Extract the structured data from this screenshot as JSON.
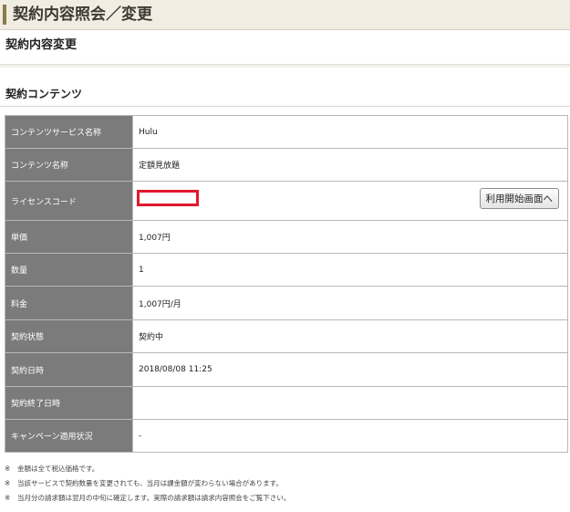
{
  "header": {
    "title": "契約内容照会／変更"
  },
  "page": {
    "subtitle": "契約内容変更"
  },
  "section": {
    "title": "契約コンテンツ"
  },
  "table": {
    "rows": [
      {
        "label": "コンテンツサービス名称",
        "value": "Hulu"
      },
      {
        "label": "コンテンツ名称",
        "value": "定額見放題"
      },
      {
        "label": "ライセンスコード",
        "value": ""
      },
      {
        "label": "単価",
        "value": "1,007円"
      },
      {
        "label": "数量",
        "value": "1"
      },
      {
        "label": "料金",
        "value": "1,007円/月"
      },
      {
        "label": "契約状態",
        "value": "契約中"
      },
      {
        "label": "契約日時",
        "value": "2018/08/08 11:25"
      },
      {
        "label": "契約終了日時",
        "value": ""
      },
      {
        "label": "キャンペーン適用状況",
        "value": "-"
      }
    ]
  },
  "actions": {
    "start_usage_button": "利用開始画面へ"
  },
  "notes": {
    "mark": "※",
    "items": [
      "金額は全て税込価格です。",
      "当該サービスで契約数量を変更されても、当月は課金額が変わらない場合があります。",
      "当月分の請求額は翌月の中旬に確定します。実際の請求額は請求内容照会をご覧下さい。"
    ]
  },
  "colors": {
    "label_bg": "#7b7b7b",
    "header_bg": "#f1ede2",
    "header_bar": "#8c7a4a",
    "redaction": "#e0192c"
  }
}
